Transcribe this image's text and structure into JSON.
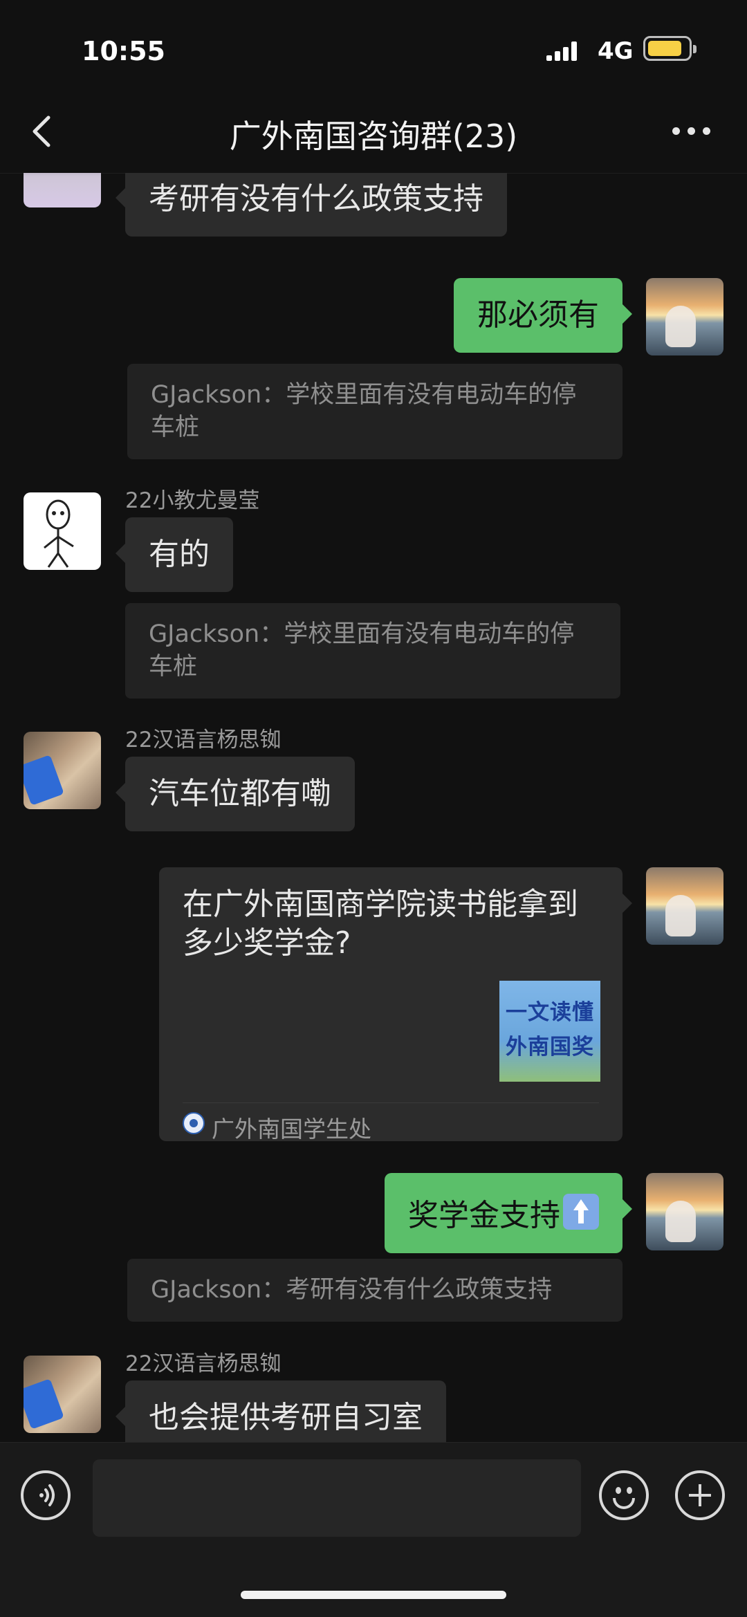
{
  "status_bar": {
    "time": "10:55",
    "network": "4G",
    "signal_bars": 4,
    "battery_level": 0.75,
    "battery_color": "#f7d046"
  },
  "header": {
    "title": "广外南国咨询群(23)",
    "back_icon": "chevron-left-icon",
    "more_icon": "more-dots-icon"
  },
  "messages": [
    {
      "type": "text",
      "direction": "received",
      "text": "考研有没有什么政策支持"
    },
    {
      "type": "text",
      "direction": "sent",
      "text": "那必须有"
    },
    {
      "type": "quote",
      "text": "GJackson：学校里面有没有电动车的停车桩"
    },
    {
      "type": "text",
      "direction": "received",
      "sender": "22小教尤曼莹",
      "text": "有的"
    },
    {
      "type": "quote",
      "text": "GJackson：学校里面有没有电动车的停车桩"
    },
    {
      "type": "text",
      "direction": "received",
      "sender": "22汉语言杨思铷",
      "text": "汽车位都有嘞"
    },
    {
      "type": "article",
      "direction": "sent",
      "title": "在广外南国商学院读书能拿到多少奖学金?",
      "thumb_text": [
        "一文读懂",
        "外南国奖"
      ],
      "source": "广外南国学生处"
    },
    {
      "type": "text",
      "direction": "sent",
      "text": "奖学金支持",
      "emoji": "up-arrow-emoji"
    },
    {
      "type": "quote",
      "text": "GJackson：考研有没有什么政策支持"
    },
    {
      "type": "text",
      "direction": "received",
      "sender": "22汉语言杨思铷",
      "text": "也会提供考研自习室"
    }
  ],
  "input_bar": {
    "voice_icon": "voice-icon",
    "emoji_icon": "emoji-icon",
    "plus_icon": "plus-icon",
    "input_value": ""
  },
  "colors": {
    "background": "#111111",
    "sent_bubble": "#5bbf6a",
    "received_bubble": "#2c2c2c"
  }
}
